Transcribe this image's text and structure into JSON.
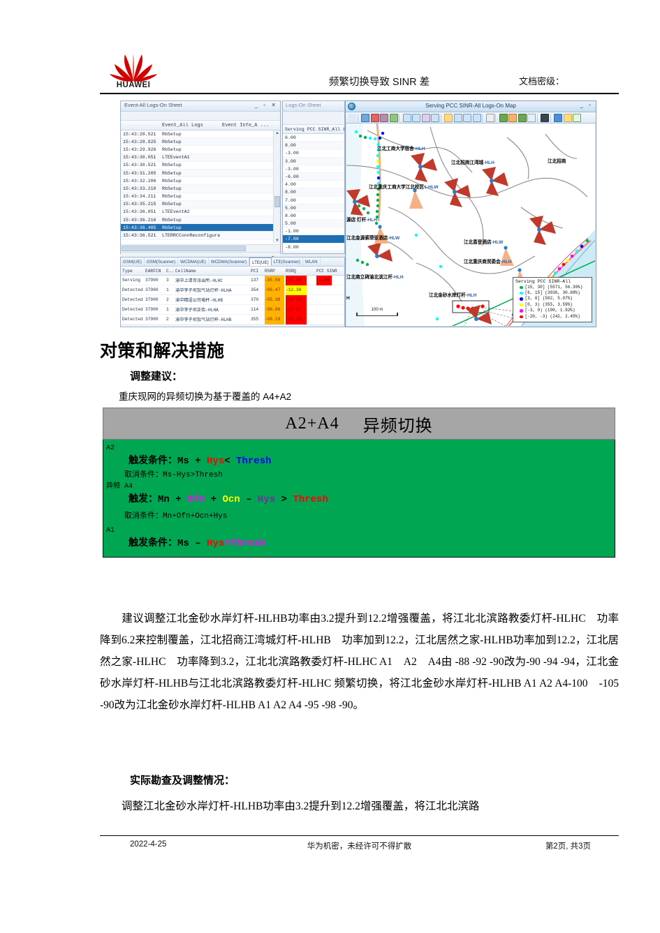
{
  "header": {
    "logo_name": "HUAWEI",
    "title": "频繁切换导致 SINR 差",
    "classification_label": "文档密级："
  },
  "screenshot": {
    "log_window": {
      "title": "Event-All Logs-On Sheet",
      "window_buttons": "_ ▫ ✕",
      "columns": [
        "",
        "Event_All Logs",
        "Event Info_A ..."
      ],
      "rows": [
        {
          "time": "15:43:28.521",
          "event": "RbSetup",
          "info": ""
        },
        {
          "time": "15:43:28.925",
          "event": "RbSetup",
          "info": ""
        },
        {
          "time": "15:43:29.926",
          "event": "RbSetup",
          "info": ""
        },
        {
          "time": "15:43:30.051",
          "event": "LTEEventA1",
          "info": ""
        },
        {
          "time": "15:43:30.521",
          "event": "RbSetup",
          "info": ""
        },
        {
          "time": "15:43:31.205",
          "event": "RbSetup",
          "info": ""
        },
        {
          "time": "15:43:32.206",
          "event": "RbSetup",
          "info": ""
        },
        {
          "time": "15:43:33.210",
          "event": "RbSetup",
          "info": ""
        },
        {
          "time": "15:43:34.211",
          "event": "RbSetup",
          "info": ""
        },
        {
          "time": "15:43:35.215",
          "event": "RbSetup",
          "info": ""
        },
        {
          "time": "15:43:36.051",
          "event": "LTEEventA2",
          "info": ""
        },
        {
          "time": "15:43:36.216",
          "event": "RbSetup",
          "info": ""
        },
        {
          "time": "15:43:36.485",
          "event": "RbSetup",
          "info": ""
        },
        {
          "time": "15:43:36.521",
          "event": "LTERRCConnReconfigurat",
          "info": ""
        }
      ],
      "selected_row_index": 12
    },
    "sinr_window": {
      "title": "Logs-On Sheet",
      "column_header": "Serving PCC SINR_All Lo",
      "values": [
        "6.00",
        "8.00",
        "-3.00",
        "3.00",
        "-3.00",
        "-6.00",
        "4.00",
        "8.00",
        "7.00",
        "5.00",
        "8.00",
        "5.00",
        "-1.00",
        "-7.00",
        "-8.00"
      ],
      "selected_index": 13
    },
    "map_window": {
      "title": "Serving PCC SINR-All Logs-On Map",
      "window_buttons": "_ ▫",
      "scale_label": "100 m",
      "legend_title": "Serving PCC SINR-All",
      "legend": [
        {
          "color": "#00b050",
          "label": "[15, 30] (5571, 56.30%)"
        },
        {
          "color": "#00ffff",
          "label": "[6, 15] (3036, 30.68%)"
        },
        {
          "color": "#0000ff",
          "label": "[3, 6] (502, 5.07%)"
        },
        {
          "color": "#ffff00",
          "label": "[0, 3) (355, 3.59%)"
        },
        {
          "color": "#ff00ff",
          "label": "[-3, 0) (190, 1.92%)"
        },
        {
          "color": "#ff0000",
          "label": "[-20, -3) (242, 2.45%)"
        }
      ],
      "site_labels": [
        "江北工商大学宿舍-HLH",
        "江北重庆工商大学江北校区1-HLW",
        "江北招商江湾城-HLH",
        "江北招商",
        "江北金源酒店灯杆-HLH",
        "江北金源索菲亚酒店-HLW",
        "江北喜登酒店-HLW",
        "江北重庆商贸委会-HLH",
        "江北商立碑渝北滨江杆-HLH",
        "江北金砂水岸灯杆-HLH"
      ]
    },
    "cell_table": {
      "tabs": [
        "GSM(UE)",
        "GSM(Scanner)",
        "WCDMA(UE)",
        "WCDMA(Scanner)",
        "LTE(UE)",
        "LTE(Scanner)",
        "WLAN"
      ],
      "active_tab": "LTE(UE)",
      "columns": [
        "Type",
        "EARFCN",
        "C..",
        "CellName",
        "PCI",
        "RSRP",
        "RSRQ",
        "PCC SINR"
      ],
      "rows": [
        {
          "type": "Serving",
          "earfcn": "37900",
          "c": "3",
          "cell": "渝中上清寺派出所-HLHC",
          "pci": "137",
          "rsrp": "-95.56",
          "rsrq": "-17.49",
          "sinr": "-2.00"
        },
        {
          "type": "Detected",
          "earfcn": "37900",
          "c": "1",
          "cell": "渝中李子坝加气站灯杆-HLHA",
          "pci": "354",
          "rsrp": "-86.47",
          "rsrq": "-12.38",
          "sinr": ""
        },
        {
          "type": "Detected",
          "earfcn": "37900",
          "c": "2",
          "cell": "渝中精语公司电杆-HLHB",
          "pci": "370",
          "rsrp": "-95.38",
          "rsrq": "-16.25",
          "sinr": ""
        },
        {
          "type": "Detected",
          "earfcn": "37900",
          "c": "1",
          "cell": "渝中李子坝正街-HLHA",
          "pci": "114",
          "rsrp": "-96.06",
          "rsrq": "-17.61",
          "sinr": ""
        },
        {
          "type": "Detected",
          "earfcn": "37900",
          "c": "2",
          "cell": "渝中李子坝加气站灯杆-HLHB",
          "pci": "355",
          "rsrp": "-98.19",
          "rsrq": "-19.19",
          "sinr": ""
        }
      ]
    }
  },
  "document": {
    "heading1": "对策和解决措施",
    "heading2": "调整建议：",
    "intro": "重庆现网的异频切换为基于覆盖的 A4+A2",
    "green_box": {
      "title_left": "A2+A4",
      "title_right": "异频切换",
      "a2_label": "A2",
      "a2_trigger_prefix": "触发条件：Ms +",
      "a2_trigger_hys": "Hys",
      "a2_trigger_op": "<",
      "a2_trigger_thresh": "Thresh",
      "a2_cancel": "取消条件：Ms-Hys>Thresh",
      "a4_label": "异频 A4",
      "a4_trigger_prefix": "触发：Mn +",
      "a4_ofn": "Ofn",
      "a4_plus": "+",
      "a4_ocn": "Ocn",
      "a4_minus": "–",
      "a4_hys": "Hys",
      "a4_gt": ">",
      "a4_thresh": "Thresh",
      "a4_cancel": "取消条件：Mn+Ofn+Ocn+Hys",
      "a1_label": "A1",
      "a1_trigger_prefix": "触发条件：Ms –",
      "a1_hys": "Hys",
      "a1_op_thresh": ">Thresh"
    },
    "paragraph1": "建议调整江北金砂水岸灯杆-HLHB功率由3.2提升到12.2增强覆盖，将江北北滨路教委灯杆-HLHC　功率降到6.2来控制覆盖，江北招商江湾城灯杆-HLHB　功率加到12.2，江北居然之家-HLHB功率加到12.2，江北居然之家-HLHC　功率降到3.2，江北北滨路教委灯杆-HLHC A1　A2　A4由 -88 -92 -90改为-90 -94 -94，江北金砂水岸灯杆-HLHB与江北北滨路教委灯杆-HLHC 频繁切换，将江北金砂水岸灯杆-HLHB A1 A2 A4-100　-105 -90改为江北金砂水岸灯杆-HLHB A1 A2 A4 -95 -98 -90。",
    "heading3": "实际勘查及调整情况：",
    "paragraph2": "调整江北金砂水岸灯杆-HLHB功率由3.2提升到12.2增强覆盖，将江北北滨路"
  },
  "footer": {
    "date": "2022-4-25",
    "confidential": "华为机密，未经许可不得扩散",
    "pages": "第2页, 共3页"
  }
}
